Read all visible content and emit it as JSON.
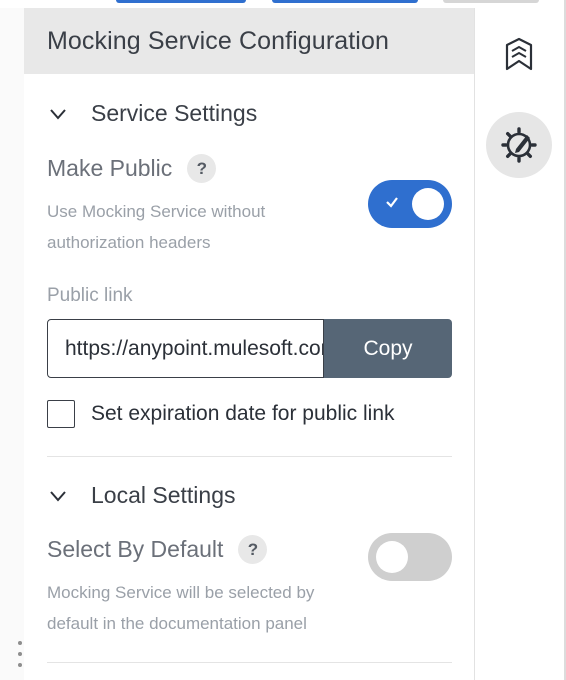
{
  "panel": {
    "title": "Mocking Service Configuration"
  },
  "service_settings": {
    "title": "Service Settings",
    "make_public": {
      "label": "Make Public",
      "help": "?",
      "description": "Use Mocking Service without authorization headers",
      "enabled": true
    },
    "public_link": {
      "label": "Public link",
      "value": "https://anypoint.mulesoft.com",
      "copy_label": "Copy"
    },
    "expiration": {
      "label": "Set expiration date for public link",
      "checked": false
    }
  },
  "local_settings": {
    "title": "Local Settings",
    "select_by_default": {
      "label": "Select By Default",
      "help": "?",
      "description": "Mocking Service will be selected by default in the documentation panel",
      "enabled": false
    }
  },
  "rail": {
    "items": [
      {
        "icon": "bookmark-icon",
        "active": false
      },
      {
        "icon": "gear-pencil-icon",
        "active": true
      }
    ]
  },
  "colors": {
    "accent": "#2f6fcf",
    "copy_button": "#566676",
    "header_bg": "#e8e8e8"
  }
}
